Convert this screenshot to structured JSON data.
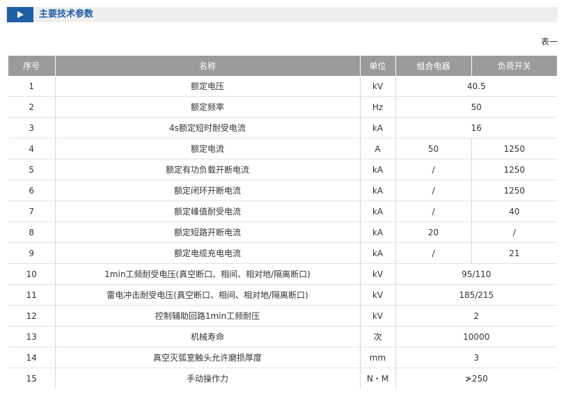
{
  "section": {
    "title": "主要技术参数",
    "icon": "play-triangle-icon"
  },
  "table_tag": "表一",
  "table": {
    "headers": [
      "序号",
      "名称",
      "单位",
      "组合电器",
      "负荷开关"
    ],
    "rows": [
      {
        "no": "1",
        "name": "额定电压",
        "unit": "kV",
        "merged": "40.5"
      },
      {
        "no": "2",
        "name": "额定频率",
        "unit": "Hz",
        "merged": "50"
      },
      {
        "no": "3",
        "name": "4s额定短时耐受电流",
        "unit": "kA",
        "merged": "16"
      },
      {
        "no": "4",
        "name": "额定电流",
        "unit": "A",
        "combo": "50",
        "switch": "1250"
      },
      {
        "no": "5",
        "name": "额定有功负载开断电流",
        "unit": "kA",
        "combo": "/",
        "switch": "1250"
      },
      {
        "no": "6",
        "name": "额定闭环开断电流",
        "unit": "kA",
        "combo": "/",
        "switch": "1250"
      },
      {
        "no": "7",
        "name": "额定峰值耐受电流",
        "unit": "kA",
        "combo": "/",
        "switch": "40"
      },
      {
        "no": "8",
        "name": "额定短路开断电流",
        "unit": "kA",
        "combo": "20",
        "switch": "/"
      },
      {
        "no": "9",
        "name": "额定电缆充电电流",
        "unit": "kA",
        "combo": "/",
        "switch": "21"
      },
      {
        "no": "10",
        "name": "1min工频耐受电压(真空断口、相间、相对地/隔离断口)",
        "unit": "kV",
        "merged": "95/110"
      },
      {
        "no": "11",
        "name": "雷电冲击耐受电压(真空断口、相间、相对地/隔离断口)",
        "unit": "kV",
        "merged": "185/215"
      },
      {
        "no": "12",
        "name": "控制辅助回路1min工频耐压",
        "unit": "kV",
        "merged": "2"
      },
      {
        "no": "13",
        "name": "机械寿命",
        "unit": "次",
        "merged": "10000"
      },
      {
        "no": "14",
        "name": "真空灭弧室触头允许磨损厚度",
        "unit": "mm",
        "merged": "3"
      },
      {
        "no": "15",
        "name": "手动操作力",
        "unit": "N・M",
        "merged": "≯250"
      }
    ]
  },
  "colors": {
    "accent": "#1f5fa8",
    "header_bg": "#9b9b9b",
    "bar_bg": "#efefef"
  }
}
